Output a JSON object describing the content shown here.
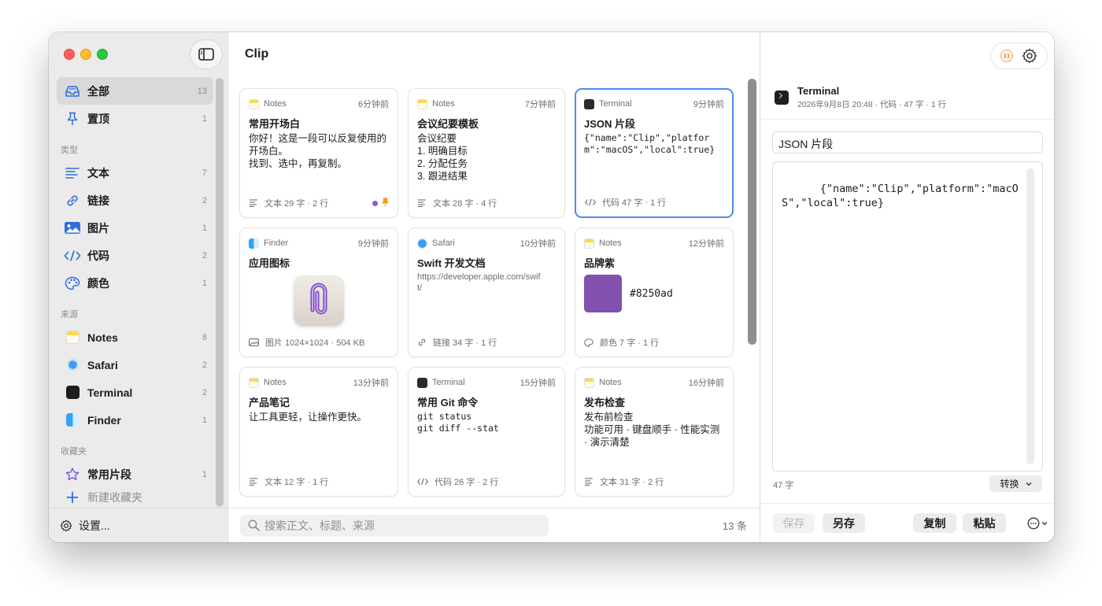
{
  "sidebar": {
    "items": [
      {
        "label": "全部",
        "count": "13",
        "icon": "tray-icon"
      },
      {
        "label": "置顶",
        "count": "1",
        "icon": "pin-icon"
      }
    ],
    "type_section": "类型",
    "types": [
      {
        "label": "文本",
        "count": "7",
        "icon": "text-lines-icon"
      },
      {
        "label": "链接",
        "count": "2",
        "icon": "link-icon"
      },
      {
        "label": "图片",
        "count": "1",
        "icon": "photo-icon"
      },
      {
        "label": "代码",
        "count": "2",
        "icon": "code-icon"
      },
      {
        "label": "颜色",
        "count": "1",
        "icon": "palette-icon"
      }
    ],
    "source_section": "来源",
    "sources": [
      {
        "label": "Notes",
        "count": "8",
        "icon": "notes-app-icon"
      },
      {
        "label": "Safari",
        "count": "2",
        "icon": "safari-app-icon"
      },
      {
        "label": "Terminal",
        "count": "2",
        "icon": "terminal-app-icon"
      },
      {
        "label": "Finder",
        "count": "1",
        "icon": "finder-app-icon"
      }
    ],
    "collection_section": "收藏夹",
    "collections": [
      {
        "label": "常用片段",
        "count": "1",
        "icon": "star-icon"
      }
    ],
    "new_collection": "新建收藏夹",
    "settings": "设置..."
  },
  "main": {
    "title": "Clip",
    "search_placeholder": "搜索正文、标题、来源",
    "count_label": "13 条",
    "cards": [
      {
        "app": "Notes",
        "time": "6分钟前",
        "title": "常用开场白",
        "body": "你好！这是一段可以反复使用的开场白。\n找到、选中，再复制。",
        "foot": "文本 29 字 · 2 行",
        "kind": "text"
      },
      {
        "app": "Notes",
        "time": "7分钟前",
        "title": "会议纪要模板",
        "body": "会议纪要\n1. 明确目标\n2. 分配任务\n3. 跟进结果",
        "foot": "文本 28 字 · 4 行",
        "kind": "text"
      },
      {
        "app": "Terminal",
        "time": "9分钟前",
        "title": "JSON 片段",
        "body": "{\"name\":\"Clip\",\"platform\":\"macOS\",\"local\":true}",
        "foot": "代码 47 字 · 1 行",
        "kind": "code"
      },
      {
        "app": "Finder",
        "time": "9分钟前",
        "title": "应用图标",
        "body": "",
        "foot": "图片 1024×1024 · 504 KB",
        "kind": "image"
      },
      {
        "app": "Safari",
        "time": "10分钟前",
        "title": "Swift 开发文档",
        "body": "https://developer.apple.com/swift/",
        "foot": "链接 34 字 · 1 行",
        "kind": "link"
      },
      {
        "app": "Notes",
        "time": "12分钟前",
        "title": "品牌紫",
        "body": "#8250ad",
        "foot": "颜色 7 字 · 1 行",
        "kind": "color"
      },
      {
        "app": "Notes",
        "time": "13分钟前",
        "title": "产品笔记",
        "body": "让工具更轻，让操作更快。",
        "foot": "文本 12 字 · 1 行",
        "kind": "text"
      },
      {
        "app": "Terminal",
        "time": "15分钟前",
        "title": "常用 Git 命令",
        "body": "git status\ngit diff --stat",
        "foot": "代码 26 字 · 2 行",
        "kind": "code"
      },
      {
        "app": "Notes",
        "time": "16分钟前",
        "title": "发布检查",
        "body": "发布前检查\n功能可用 · 键盘顺手 · 性能实测 · 演示清楚",
        "foot": "文本 31 字 · 2 行",
        "kind": "text"
      }
    ]
  },
  "detail": {
    "app": "Terminal",
    "meta": "2026年9月8日 20:48 · 代码 · 47 字 · 1 行",
    "title_value": "JSON 片段",
    "content": "{\"name\":\"Clip\",\"platform\":\"macOS\",\"local\":true}",
    "char_count": "47 字",
    "convert_label": "转换",
    "save_label": "保存",
    "save_as_label": "另存",
    "copy_label": "复制",
    "paste_label": "粘贴"
  },
  "colors": {
    "accent": "#4a8ff0",
    "brand_purple": "#8250ad",
    "sidebar_bg": "#ebebeb",
    "pause_orange": "#f5a25c"
  }
}
